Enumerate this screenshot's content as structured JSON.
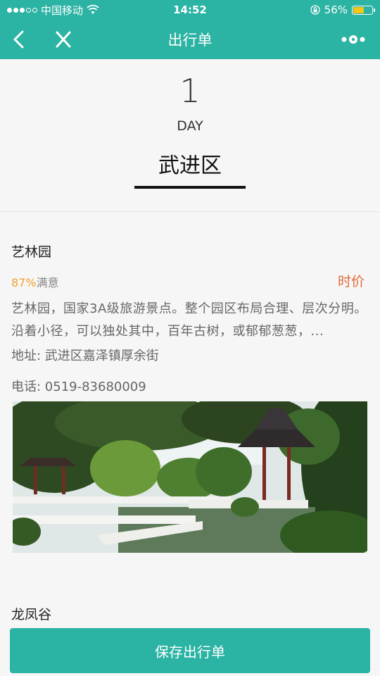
{
  "status_bar": {
    "carrier": "中国移动",
    "time": "14:52",
    "battery": "56%",
    "battery_level": 0.56
  },
  "nav": {
    "title": "出行单",
    "back_icon": "chevron-left-icon",
    "close_icon": "close-icon",
    "more_icon": "more-dots-icon"
  },
  "day": {
    "number": "1",
    "label": "DAY",
    "district": "武进区"
  },
  "spots": [
    {
      "name": "艺林园",
      "rating_pct": "87%",
      "rating_label": "满意",
      "price": "时价",
      "description": "艺林园，国家3A级旅游景点。整个园区布局合理、层次分明。沿着小径，可以独处其中，百年古树，或郁郁葱葱，...",
      "address": "地址: 武进区嘉泽镇厚余街",
      "phone": "电话: 0519-83680009"
    },
    {
      "name": "龙凤谷"
    }
  ],
  "save_label": "保存出行单",
  "colors": {
    "brand": "#2bb3a3",
    "rating": "#f0a030",
    "price": "#e0693a"
  }
}
